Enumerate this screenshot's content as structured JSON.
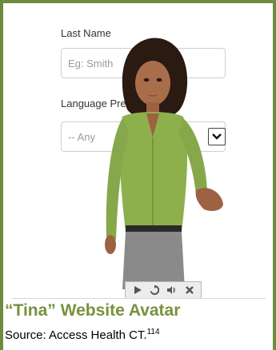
{
  "form": {
    "last_name_label": "Last Name",
    "last_name_placeholder": "Eg: Smith",
    "language_label": "Language Preference",
    "language_value": "-- Any"
  },
  "player_controls": [
    "play-icon",
    "replay-icon",
    "volume-icon",
    "close-icon"
  ],
  "caption": {
    "title": "“Tina” Website Avatar",
    "source": "Source: Access Health CT.",
    "footnote": "114"
  },
  "colors": {
    "border": "#6e8b3d",
    "caption_title": "#76923c",
    "blouse": "#8db04d",
    "skirt": "#8a8a8a"
  }
}
